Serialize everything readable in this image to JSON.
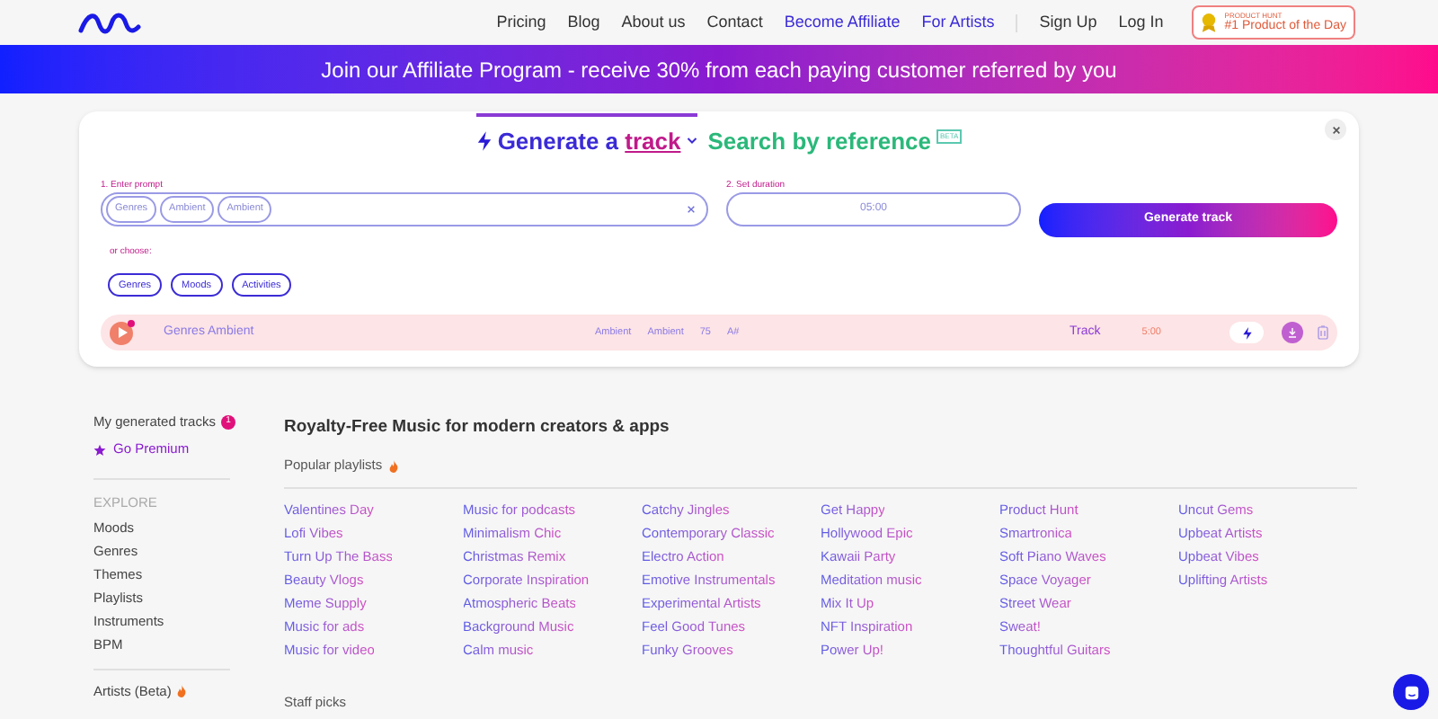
{
  "header": {
    "nav": [
      {
        "label": "Pricing",
        "kind": "plain"
      },
      {
        "label": "Blog",
        "kind": "plain"
      },
      {
        "label": "About us",
        "kind": "plain"
      },
      {
        "label": "Contact",
        "kind": "plain"
      },
      {
        "label": "Become Affiliate",
        "kind": "accent"
      },
      {
        "label": "For Artists",
        "kind": "accent"
      }
    ],
    "auth": [
      "Sign Up",
      "Log In"
    ],
    "badge": {
      "small": "PRODUCT HUNT",
      "label": "#1 Product of the Day"
    }
  },
  "banner": "Join our Affiliate Program - receive 30% from each paying customer referred by you",
  "generator": {
    "tabs": [
      {
        "prefix": "Generate a",
        "highlight": "track",
        "selected": true
      },
      {
        "label": "Search by reference",
        "badge": "BETA",
        "selected": false
      }
    ],
    "prompt": {
      "label": "1. Enter prompt",
      "chips": [
        "Genres",
        "Ambient",
        "Ambient"
      ]
    },
    "duration": {
      "label": "2. Set duration",
      "value": "05:00"
    },
    "button": "Generate track",
    "or_choose": "or choose:",
    "choices": [
      "Genres",
      "Moods",
      "Activities"
    ],
    "track": {
      "title": "Genres Ambient",
      "tags": [
        "Ambient",
        "Ambient",
        "75",
        "A#"
      ],
      "type": "Track",
      "duration": "5:00"
    }
  },
  "sidebar": {
    "my_tracks": {
      "label": "My generated tracks",
      "count": "1"
    },
    "premium": "Go Premium",
    "explore": "EXPLORE",
    "items": [
      "Moods",
      "Genres",
      "Themes",
      "Playlists",
      "Instruments",
      "BPM"
    ],
    "artists": "Artists (Beta)"
  },
  "main": {
    "title": "Royalty-Free Music for modern creators & apps",
    "popular": "Popular playlists",
    "columns": [
      [
        "Valentines Day",
        "Lofi Vibes",
        "Turn Up The Bass",
        "Beauty Vlogs",
        "Meme Supply",
        "Music for ads",
        "Music for video"
      ],
      [
        "Music for podcasts",
        "Minimalism Chic",
        "Christmas Remix",
        "Corporate Inspiration",
        "Atmospheric Beats",
        "Background Music",
        "Calm music"
      ],
      [
        "Catchy Jingles",
        "Contemporary Classic",
        "Electro Action",
        "Emotive Instrumentals",
        "Experimental Artists",
        "Feel Good Tunes",
        "Funky Grooves"
      ],
      [
        "Get Happy",
        "Hollywood Epic",
        "Kawaii Party",
        "Meditation music",
        "Mix It Up",
        "NFT Inspiration",
        "Power Up!"
      ],
      [
        "Product Hunt",
        "Smartronica",
        "Soft Piano Waves",
        "Space Voyager",
        "Street Wear",
        "Sweat!",
        "Thoughtful Guitars"
      ],
      [
        "Uncut Gems",
        "Upbeat Artists",
        "Upbeat Vibes",
        "Uplifting Artists"
      ]
    ],
    "staff": "Staff picks"
  }
}
